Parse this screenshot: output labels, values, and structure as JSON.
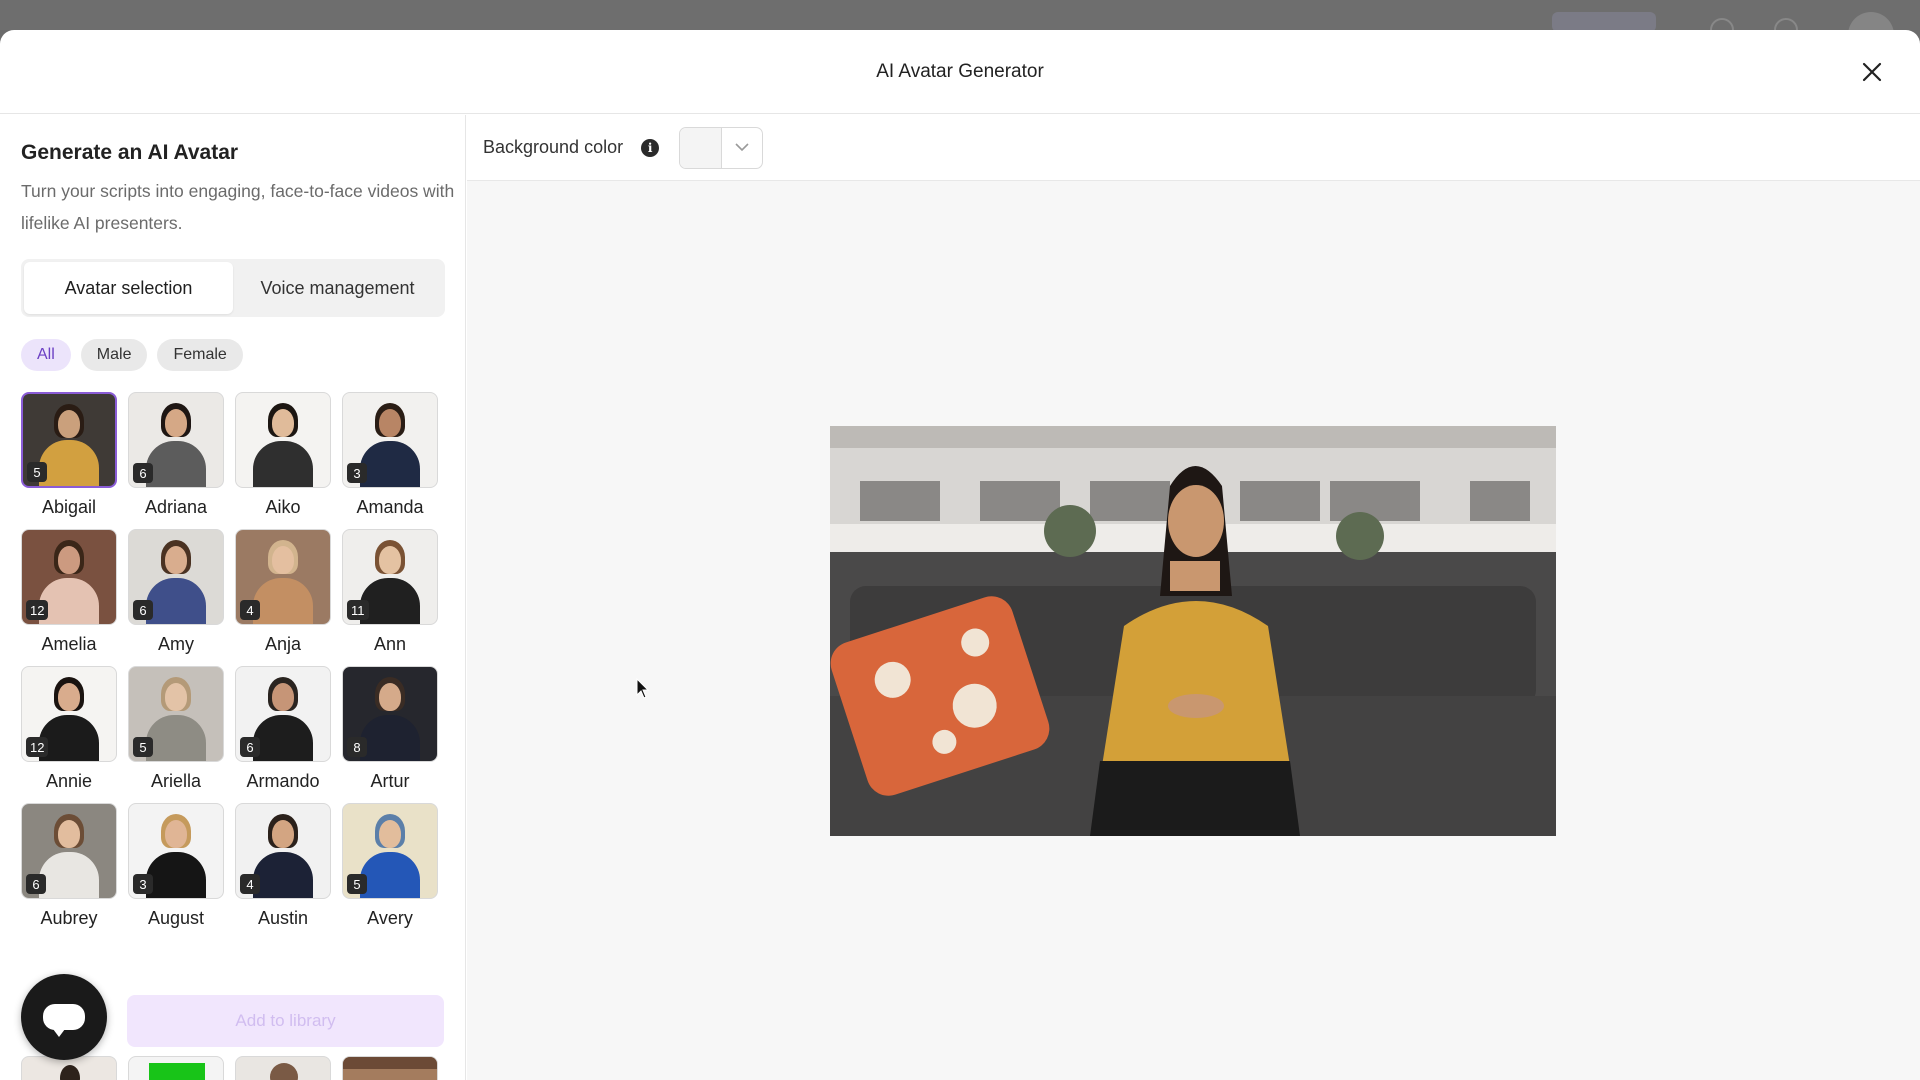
{
  "modal": {
    "title": "AI Avatar Generator"
  },
  "sidebar": {
    "title": "Generate an AI Avatar",
    "description": "Turn your scripts into engaging, face-to-face videos with lifelike AI presenters.",
    "tabs": [
      {
        "label": "Avatar selection",
        "active": true
      },
      {
        "label": "Voice management",
        "active": false
      }
    ],
    "filters": [
      {
        "label": "All",
        "active": true
      },
      {
        "label": "Male",
        "active": false
      },
      {
        "label": "Female",
        "active": false
      }
    ],
    "avatars": [
      {
        "name": "Abigail",
        "count": "5",
        "selected": true
      },
      {
        "name": "Adriana",
        "count": "6",
        "selected": false
      },
      {
        "name": "Aiko",
        "count": "",
        "selected": false
      },
      {
        "name": "Amanda",
        "count": "3",
        "selected": false
      },
      {
        "name": "Amelia",
        "count": "12",
        "selected": false
      },
      {
        "name": "Amy",
        "count": "6",
        "selected": false
      },
      {
        "name": "Anja",
        "count": "4",
        "selected": false
      },
      {
        "name": "Ann",
        "count": "11",
        "selected": false
      },
      {
        "name": "Annie",
        "count": "12",
        "selected": false
      },
      {
        "name": "Ariella",
        "count": "5",
        "selected": false
      },
      {
        "name": "Armando",
        "count": "6",
        "selected": false
      },
      {
        "name": "Artur",
        "count": "8",
        "selected": false
      },
      {
        "name": "Aubrey",
        "count": "6",
        "selected": false
      },
      {
        "name": "August",
        "count": "3",
        "selected": false
      },
      {
        "name": "Austin",
        "count": "4",
        "selected": false
      },
      {
        "name": "Avery",
        "count": "5",
        "selected": false
      }
    ],
    "add_button_label": "Add to library"
  },
  "toolbar": {
    "background_color_label": "Background color"
  }
}
